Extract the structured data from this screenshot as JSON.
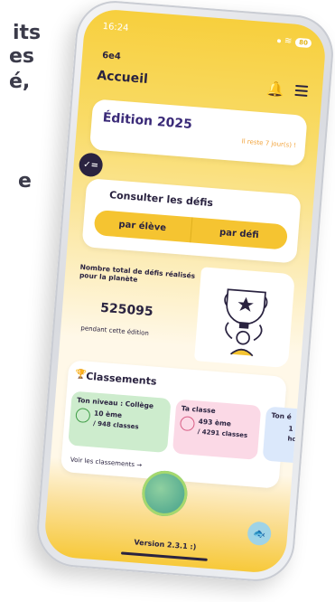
{
  "background_text": {
    "lines": [
      "its",
      "es",
      "é,",
      "",
      "e"
    ]
  },
  "status_bar": {
    "time": "16:24",
    "battery": "80"
  },
  "header": {
    "group": "6e4",
    "title": "Accueil"
  },
  "edition_card": {
    "title": "Édition 2025",
    "remaining": "Il reste 7 jour(s) !"
  },
  "defis_card": {
    "badge": "✓=",
    "title": "Consulter les défis",
    "buttons": [
      "par élève",
      "par défi"
    ]
  },
  "stats_card": {
    "label": "Nombre total de défis réalisés pour la planète",
    "value": "525095",
    "period": "pendant cette édition"
  },
  "classements": {
    "title": "Classements",
    "tiles": [
      {
        "title": "Ton niveau : Collège",
        "rank": "10",
        "suffix": "ème",
        "total": "/ 948 classes",
        "color": "#3c9b44"
      },
      {
        "title": "Ta classe",
        "rank": "493",
        "suffix": "ème",
        "total": "/ 4291 classes",
        "color": "#d85c84"
      },
      {
        "title": "Ton é",
        "rank": "1",
        "suffix": "",
        "total": "ho",
        "color": "#4a6fb0"
      }
    ],
    "see_all": "Voir les classements →"
  },
  "footer": {
    "version": "Version 2.3.1 :)"
  },
  "colors": {
    "primary_yellow": "#f5c431",
    "dark": "#2a2340",
    "edition_purple": "#3a2a78",
    "remaining_orange": "#f2a33a"
  }
}
